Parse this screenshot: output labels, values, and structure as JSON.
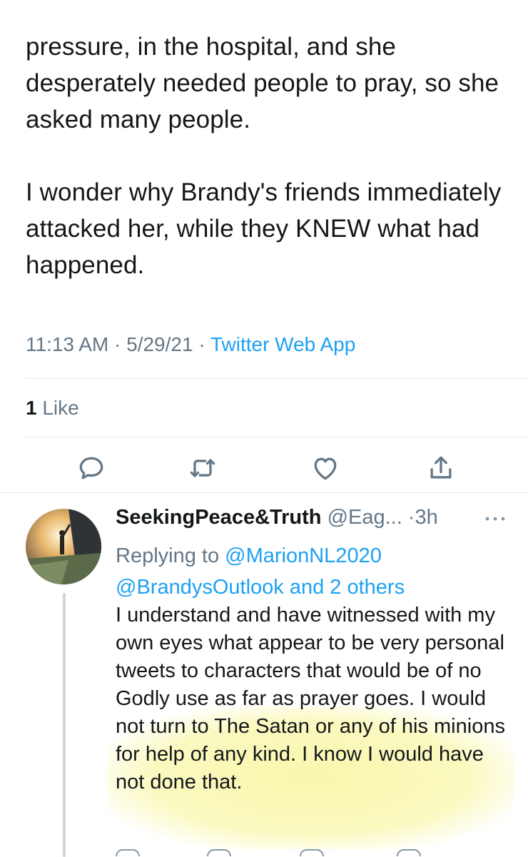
{
  "tweet": {
    "paragraph1": "pressure, in the hospital, and she desperately needed people to pray, so she asked many people.",
    "paragraph2": "I wonder why Brandy's friends immediately attacked her, while they KNEW what had happened.",
    "time": "11:13 AM",
    "date": "5/29/21",
    "separator": "·",
    "source": "Twitter Web App",
    "likes_count": "1",
    "likes_label": "Like"
  },
  "actions": [
    {
      "icon": "reply-icon"
    },
    {
      "icon": "retweet-icon"
    },
    {
      "icon": "heart-icon"
    },
    {
      "icon": "share-icon"
    }
  ],
  "reply": {
    "display_name": "SeekingPeace&Truth",
    "handle": "@Eag...",
    "time": "·3h",
    "replying_prefix": "Replying to",
    "mention1": "@MarionNL2020",
    "mention2": "@BrandysOutlook",
    "and_others": "and 2 others",
    "text": "I understand and have witnessed with my own eyes what appear to be very personal tweets to characters that would be of no Godly use as far as prayer goes. I would not turn to The Satan or any of his minions for help of any kind. I know I would have not done that."
  },
  "colors": {
    "accent": "#1da1f2",
    "secondary_text": "#657786",
    "highlight": "#f8f6a8"
  }
}
